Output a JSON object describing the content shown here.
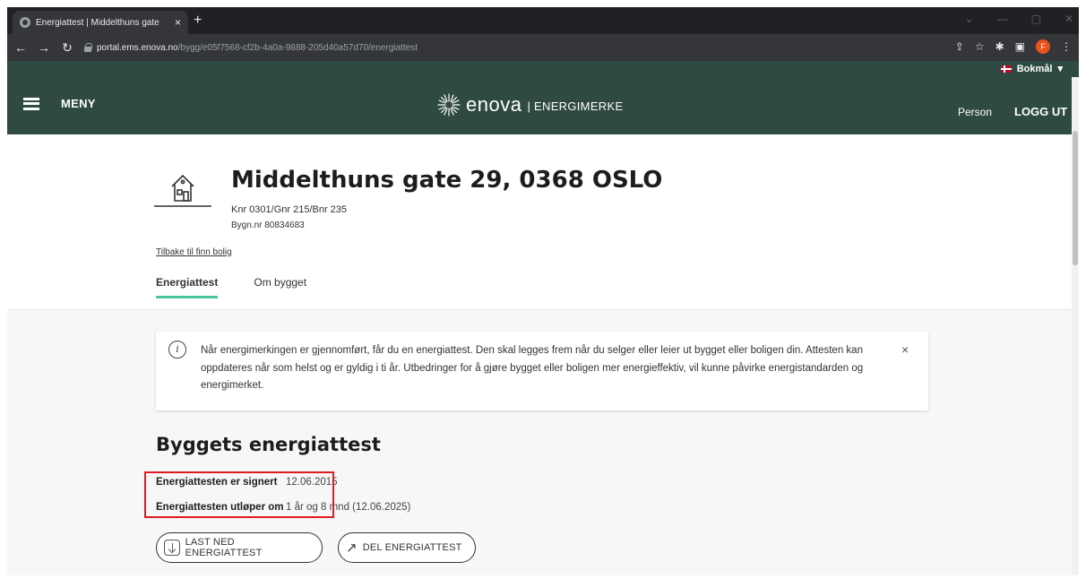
{
  "browser": {
    "tab_title": "Energiattest | Middelthuns gate",
    "tab_close": "×",
    "new_tab": "+",
    "url_host": "portal.ems.enova.no",
    "url_path": "/bygg/e05f7568-cf2b-4a0a-9888-205d40a57d70/energiattest",
    "profile_initial": "F"
  },
  "site": {
    "language": "Bokmål",
    "menu_label": "MENY",
    "logo_word": "enova",
    "logo_sub": "| ENERGIMERKE",
    "person_label": "Person",
    "logout_label": "LOGG UT"
  },
  "building": {
    "title": "Middelthuns gate 29, 0368 OSLO",
    "knr": "Knr 0301/Gnr 215/Bnr 235",
    "bygg_nr": "Bygn.nr 80834683",
    "back_link": "Tilbake til finn bolig",
    "tabs": [
      {
        "label": "Energiattest"
      },
      {
        "label": "Om bygget"
      }
    ]
  },
  "info": {
    "icon": "i",
    "text": "Når energimerkingen er gjennomført, får du en energiattest. Den skal legges frem når du selger eller leier ut bygget eller boligen din. Attesten kan oppdateres når som helst og er gyldig i ti år. Utbedringer for å gjøre bygget eller boligen mer energieffektiv, vil kunne påvirke energistandarden og energimerket.",
    "close": "×"
  },
  "certificate": {
    "title": "Byggets energiattest",
    "signed_label": "Energiattesten er signert",
    "signed_value": "12.06.2015",
    "expires_label": "Energiattesten utløper om",
    "expires_value": "1 år og 8 mnd (12.06.2025)",
    "download_label": "LAST NED ENERGIATTEST",
    "share_label": "DEL ENERGIATTEST"
  },
  "colors": {
    "header_bg": "#2e4a43",
    "tab_underline": "#4bc59a",
    "highlight": "#e11b22"
  }
}
